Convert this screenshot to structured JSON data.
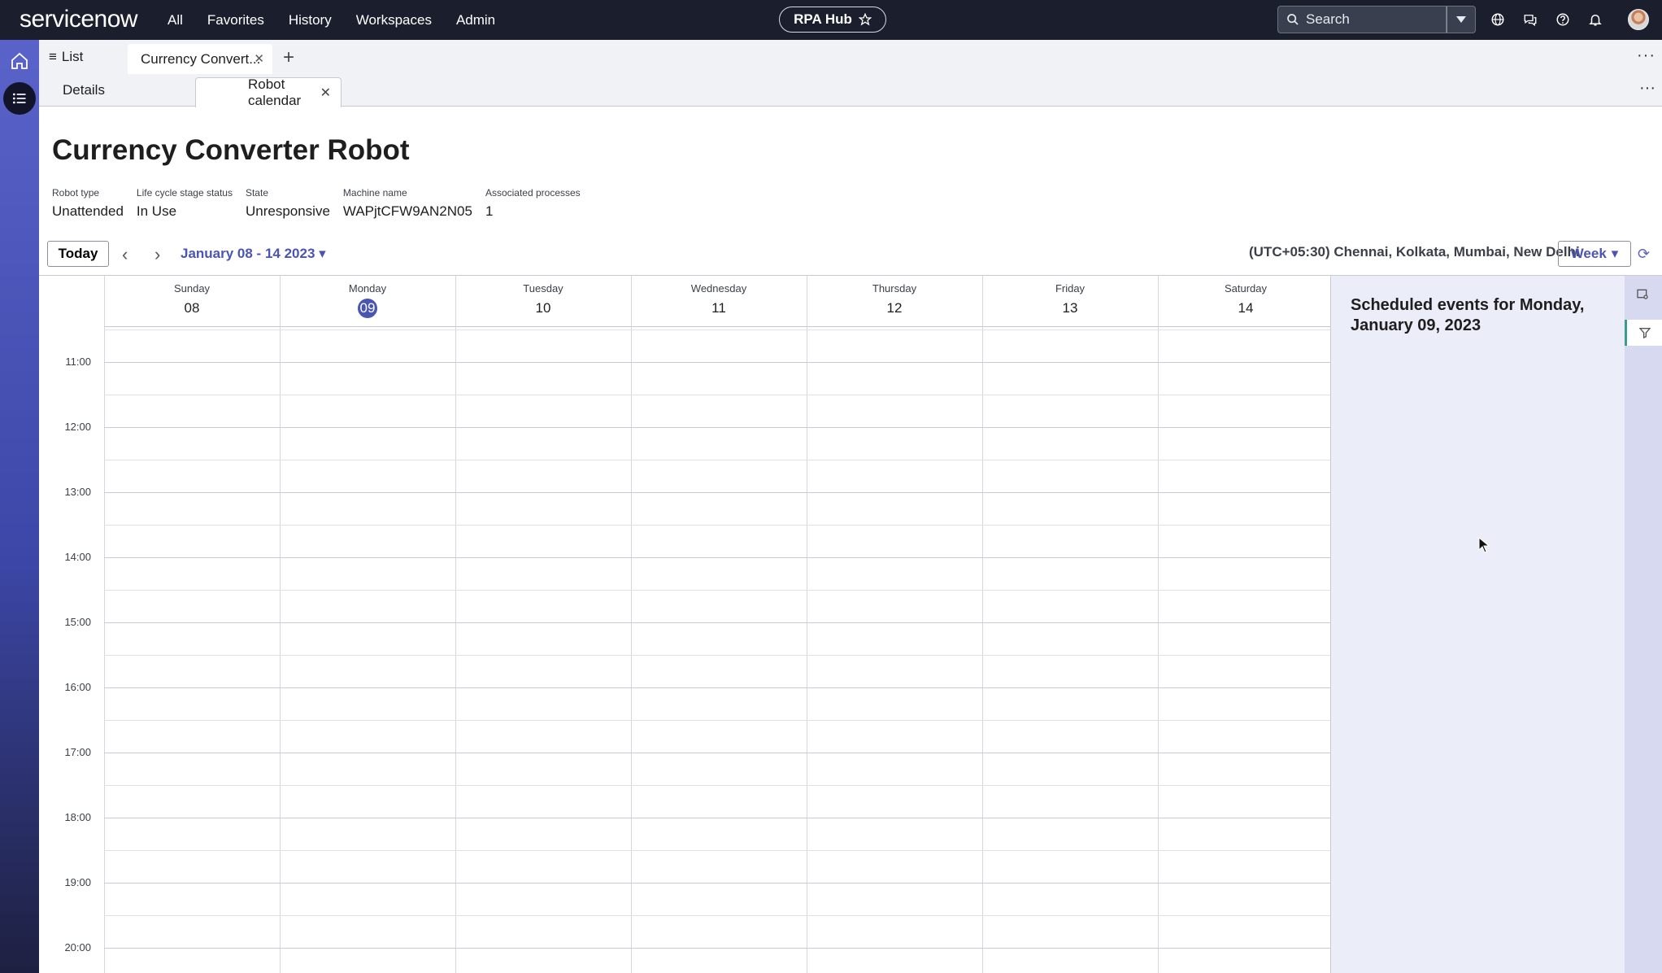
{
  "topnav": {
    "logo": "servicenow",
    "links": [
      "All",
      "Favorites",
      "History",
      "Workspaces",
      "Admin"
    ],
    "hub_label": "RPA Hub",
    "search_placeholder": "Search"
  },
  "tabs": {
    "list_label": "List",
    "active_tab": "Currency Convert...",
    "sub_tabs": [
      "Details",
      "Robot calendar"
    ]
  },
  "record": {
    "title": "Currency Converter Robot",
    "fields": [
      {
        "label": "Robot type",
        "value": "Unattended"
      },
      {
        "label": "Life cycle stage status",
        "value": "In Use"
      },
      {
        "label": "State",
        "value": "Unresponsive"
      },
      {
        "label": "Machine name",
        "value": "WAPjtCFW9AN2N05"
      },
      {
        "label": "Associated processes",
        "value": "1"
      }
    ]
  },
  "calendar": {
    "today_label": "Today",
    "range_label": "January 08 - 14 2023",
    "timezone": "(UTC+05:30) Chennai, Kolkata, Mumbai, New Delhi",
    "view_label": "Week",
    "days": [
      {
        "name": "Sunday",
        "num": "08"
      },
      {
        "name": "Monday",
        "num": "09",
        "current": true
      },
      {
        "name": "Tuesday",
        "num": "10"
      },
      {
        "name": "Wednesday",
        "num": "11"
      },
      {
        "name": "Thursday",
        "num": "12"
      },
      {
        "name": "Friday",
        "num": "13"
      },
      {
        "name": "Saturday",
        "num": "14"
      }
    ],
    "hours": [
      "11:00",
      "12:00",
      "13:00",
      "14:00",
      "15:00",
      "16:00",
      "17:00",
      "18:00",
      "19:00",
      "20:00"
    ]
  },
  "sidepanel": {
    "heading": "Scheduled events for Monday, January 09, 2023"
  },
  "colors": {
    "accent": "#4a54b3",
    "nav_bg": "#1b1f2d"
  }
}
